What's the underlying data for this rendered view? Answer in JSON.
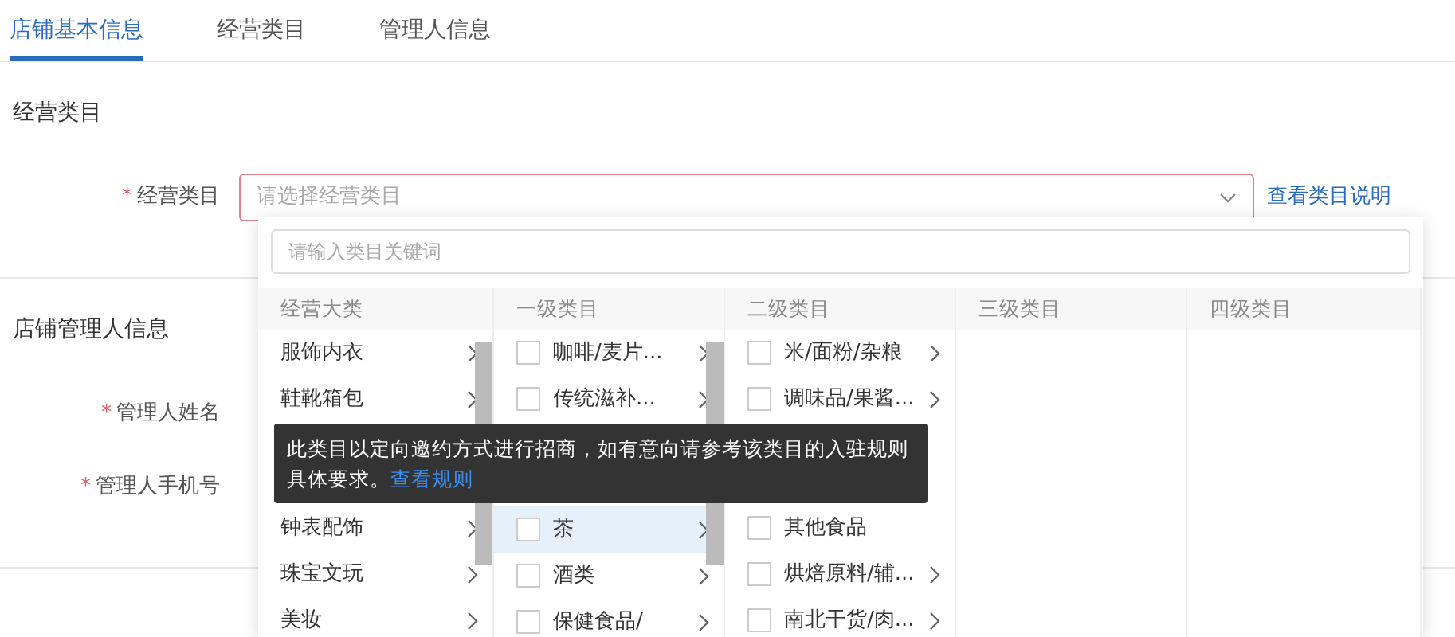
{
  "tabs": [
    {
      "label": "店铺基本信息",
      "selected": true
    },
    {
      "label": "经营类目",
      "selected": false
    },
    {
      "label": "管理人信息",
      "selected": false
    }
  ],
  "sections": [
    {
      "title": "经营类目",
      "fields": [
        {
          "label": "经营类目",
          "marker": "*",
          "kind": "select",
          "placeholder": "请选择经营类目",
          "link": "查看类目说明"
        }
      ]
    },
    {
      "title": "店铺管理人信息",
      "fields": [
        {
          "label": "管理人姓名",
          "marker": "*",
          "kind": "text"
        },
        {
          "label": "管理人手机号",
          "marker": "*",
          "kind": "text"
        }
      ]
    }
  ],
  "dropdown": {
    "search_placeholder": "请输入类目关键词",
    "columns": [
      {
        "title": "经营大类",
        "scrollbar": true,
        "items": [
          {
            "kind": "item",
            "label": "服饰内衣",
            "arrow": true,
            "selected": false
          },
          {
            "kind": "item",
            "label": "鞋靴箱包",
            "arrow": true,
            "selected": false
          },
          {
            "kind": "covered"
          },
          {
            "kind": "item",
            "label": "钟表配饰",
            "arrow": true,
            "selected": false
          },
          {
            "kind": "item",
            "label": "珠宝文玩",
            "arrow": true,
            "selected": false
          },
          {
            "kind": "item",
            "label": "美妆",
            "arrow": true,
            "selected": false
          }
        ]
      },
      {
        "title": "一级类目",
        "scrollbar": true,
        "items": [
          {
            "kind": "item",
            "label": "咖啡/麦片...",
            "arrow": true,
            "selected": false,
            "checked": false
          },
          {
            "kind": "item",
            "label": "传统滋补...",
            "arrow": true,
            "selected": false,
            "checked": false
          },
          {
            "kind": "covered"
          },
          {
            "kind": "item",
            "label": "茶",
            "arrow": true,
            "selected": true,
            "checked": false
          },
          {
            "kind": "item",
            "label": "酒类",
            "arrow": true,
            "selected": false,
            "checked": false
          },
          {
            "kind": "item",
            "label": "保健食品/",
            "arrow": true,
            "selected": false,
            "checked": false
          }
        ]
      },
      {
        "title": "二级类目",
        "items": [
          {
            "kind": "item",
            "label": "米/面粉/杂粮",
            "arrow": true,
            "selected": false,
            "checked": false
          },
          {
            "kind": "item",
            "label": "调味品/果酱...",
            "arrow": true,
            "selected": false,
            "checked": false
          },
          {
            "kind": "covered"
          },
          {
            "kind": "item",
            "label": "其他食品",
            "arrow": false,
            "selected": false,
            "checked": false
          },
          {
            "kind": "item",
            "label": "烘焙原料/辅...",
            "arrow": true,
            "selected": false,
            "checked": false
          },
          {
            "kind": "item",
            "label": "南北干货/肉...",
            "arrow": true,
            "selected": false,
            "checked": false
          }
        ]
      },
      {
        "title": "三级类目"
      },
      {
        "title": "四级类目"
      }
    ],
    "tooltip": {
      "text": "此类目以定向邀约方式进行招商，如有意向请参考该类目的入驻规则具体要求。",
      "link": "查看规则"
    }
  }
}
